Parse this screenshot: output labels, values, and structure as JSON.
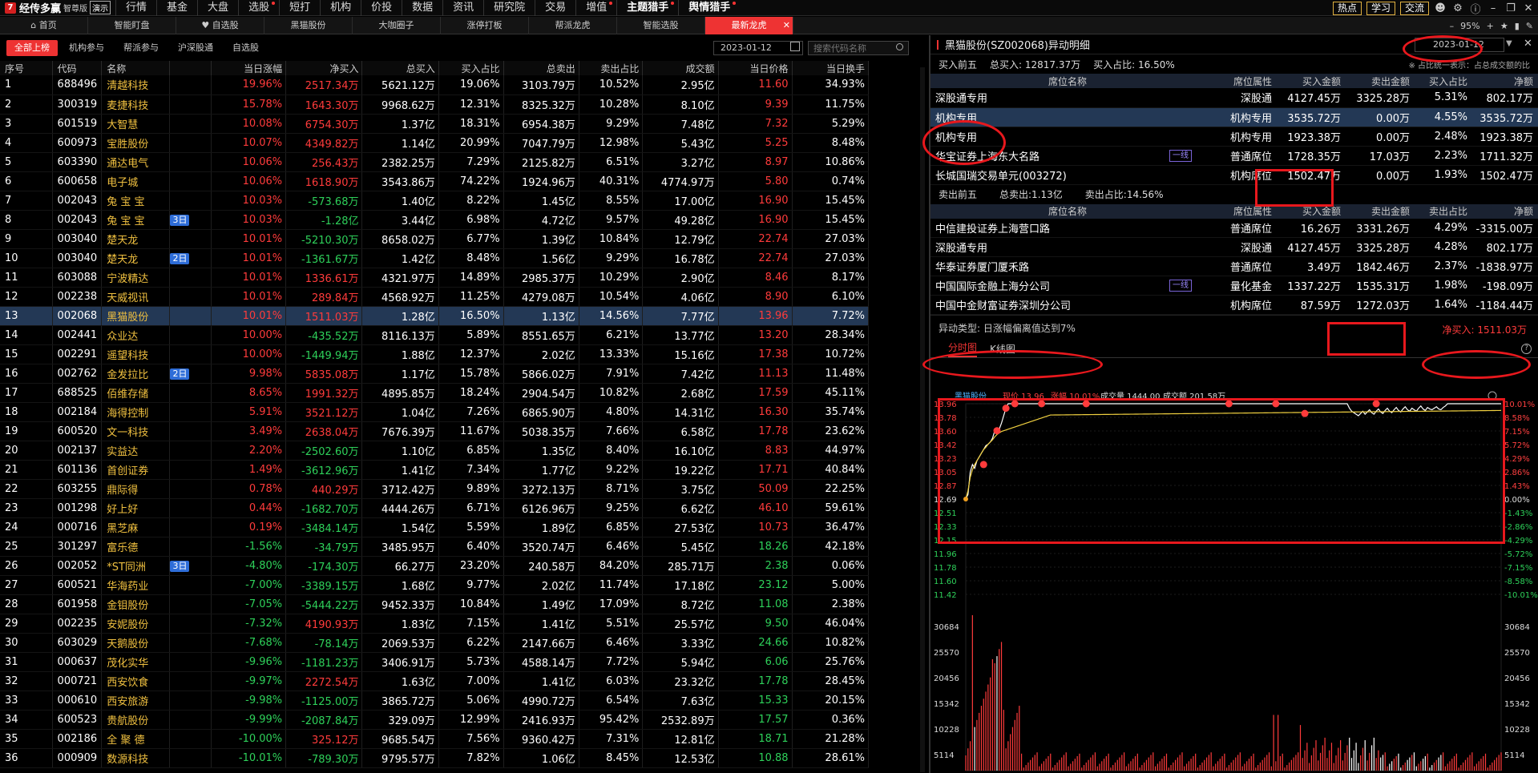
{
  "app": {
    "name": "经传多赢",
    "edition": "智尊版",
    "demo_label": "演示"
  },
  "menu": [
    "行情",
    "基金",
    "大盘",
    "选股",
    "短打",
    "机构",
    "价投",
    "数据",
    "资讯",
    "研究院",
    "交易",
    "增值",
    "主题猎手",
    "舆情猎手"
  ],
  "menu_dots": [
    3,
    11,
    12,
    13
  ],
  "top_buttons": [
    "热点",
    "学习",
    "交流"
  ],
  "tabs": [
    "首页",
    "智能盯盘",
    "自选股",
    "黑猫股份",
    "大咖圈子",
    "涨停打板",
    "帮派龙虎",
    "智能选股",
    "最新龙虎"
  ],
  "active_tab": 8,
  "zoom": "95%",
  "left": {
    "subtabs": [
      "全部上榜",
      "机构参与",
      "帮派参与",
      "沪深股通",
      "自选股"
    ],
    "date": "2023-01-12",
    "search_placeholder": "搜索代码名称",
    "headers": [
      "序号",
      "代码",
      "名称",
      "",
      "当日涨幅",
      "净买入",
      "总买入",
      "买入占比",
      "总卖出",
      "卖出占比",
      "成交额",
      "当日价格",
      "当日换手"
    ],
    "selected_row": 12,
    "rows": [
      [
        "1",
        "688496",
        "清越科技",
        "",
        "19.96%",
        "2517.34万",
        "5621.12万",
        "19.06%",
        "3103.79万",
        "10.52%",
        "2.95亿",
        "11.60",
        "34.93%"
      ],
      [
        "2",
        "300319",
        "麦捷科技",
        "",
        "15.78%",
        "1643.30万",
        "9968.62万",
        "12.31%",
        "8325.32万",
        "10.28%",
        "8.10亿",
        "9.39",
        "11.75%"
      ],
      [
        "3",
        "601519",
        "大智慧",
        "",
        "10.08%",
        "6754.30万",
        "1.37亿",
        "18.31%",
        "6954.38万",
        "9.29%",
        "7.48亿",
        "7.32",
        "5.29%"
      ],
      [
        "4",
        "600973",
        "宝胜股份",
        "",
        "10.07%",
        "4349.82万",
        "1.14亿",
        "20.99%",
        "7047.79万",
        "12.98%",
        "5.43亿",
        "5.25",
        "8.48%"
      ],
      [
        "5",
        "603390",
        "通达电气",
        "",
        "10.06%",
        "256.43万",
        "2382.25万",
        "7.29%",
        "2125.82万",
        "6.51%",
        "3.27亿",
        "8.97",
        "10.86%"
      ],
      [
        "6",
        "600658",
        "电子城",
        "",
        "10.06%",
        "1618.90万",
        "3543.86万",
        "74.22%",
        "1924.96万",
        "40.31%",
        "4774.97万",
        "5.80",
        "0.74%"
      ],
      [
        "7",
        "002043",
        "兔 宝 宝",
        "",
        "10.03%",
        "-573.68万",
        "1.40亿",
        "8.22%",
        "1.45亿",
        "8.55%",
        "17.00亿",
        "16.90",
        "15.45%"
      ],
      [
        "8",
        "002043",
        "兔 宝 宝",
        "3日",
        "10.03%",
        "-1.28亿",
        "3.44亿",
        "6.98%",
        "4.72亿",
        "9.57%",
        "49.28亿",
        "16.90",
        "15.45%"
      ],
      [
        "9",
        "003040",
        "楚天龙",
        "",
        "10.01%",
        "-5210.30万",
        "8658.02万",
        "6.77%",
        "1.39亿",
        "10.84%",
        "12.79亿",
        "22.74",
        "27.03%"
      ],
      [
        "10",
        "003040",
        "楚天龙",
        "2日",
        "10.01%",
        "-1361.67万",
        "1.42亿",
        "8.48%",
        "1.56亿",
        "9.29%",
        "16.78亿",
        "22.74",
        "27.03%"
      ],
      [
        "11",
        "603088",
        "宁波精达",
        "",
        "10.01%",
        "1336.61万",
        "4321.97万",
        "14.89%",
        "2985.37万",
        "10.29%",
        "2.90亿",
        "8.46",
        "8.17%"
      ],
      [
        "12",
        "002238",
        "天威视讯",
        "",
        "10.01%",
        "289.84万",
        "4568.92万",
        "11.25%",
        "4279.08万",
        "10.54%",
        "4.06亿",
        "8.90",
        "6.10%"
      ],
      [
        "13",
        "002068",
        "黑猫股份",
        "",
        "10.01%",
        "1511.03万",
        "1.28亿",
        "16.50%",
        "1.13亿",
        "14.56%",
        "7.77亿",
        "13.96",
        "7.72%"
      ],
      [
        "14",
        "002441",
        "众业达",
        "",
        "10.00%",
        "-435.52万",
        "8116.13万",
        "5.89%",
        "8551.65万",
        "6.21%",
        "13.77亿",
        "13.20",
        "28.34%"
      ],
      [
        "15",
        "002291",
        "遥望科技",
        "",
        "10.00%",
        "-1449.94万",
        "1.88亿",
        "12.37%",
        "2.02亿",
        "13.33%",
        "15.16亿",
        "17.38",
        "10.72%"
      ],
      [
        "16",
        "002762",
        "金发拉比",
        "2日",
        "9.98%",
        "5835.08万",
        "1.17亿",
        "15.78%",
        "5866.02万",
        "7.91%",
        "7.42亿",
        "11.13",
        "11.48%"
      ],
      [
        "17",
        "688525",
        "佰维存储",
        "",
        "8.65%",
        "1991.32万",
        "4895.85万",
        "18.24%",
        "2904.54万",
        "10.82%",
        "2.68亿",
        "17.59",
        "45.11%"
      ],
      [
        "18",
        "002184",
        "海得控制",
        "",
        "5.91%",
        "3521.12万",
        "1.04亿",
        "7.26%",
        "6865.90万",
        "4.80%",
        "14.31亿",
        "16.30",
        "35.74%"
      ],
      [
        "19",
        "600520",
        "文一科技",
        "",
        "3.49%",
        "2638.04万",
        "7676.39万",
        "11.67%",
        "5038.35万",
        "7.66%",
        "6.58亿",
        "17.78",
        "23.62%"
      ],
      [
        "20",
        "002137",
        "实益达",
        "",
        "2.20%",
        "-2502.60万",
        "1.10亿",
        "6.85%",
        "1.35亿",
        "8.40%",
        "16.10亿",
        "8.83",
        "44.97%"
      ],
      [
        "21",
        "601136",
        "首创证券",
        "",
        "1.49%",
        "-3612.96万",
        "1.41亿",
        "7.34%",
        "1.77亿",
        "9.22%",
        "19.22亿",
        "17.71",
        "40.84%"
      ],
      [
        "22",
        "603255",
        "鼎际得",
        "",
        "0.78%",
        "440.29万",
        "3712.42万",
        "9.89%",
        "3272.13万",
        "8.71%",
        "3.75亿",
        "50.09",
        "22.25%"
      ],
      [
        "23",
        "001298",
        "好上好",
        "",
        "0.44%",
        "-1682.70万",
        "4444.26万",
        "6.71%",
        "6126.96万",
        "9.25%",
        "6.62亿",
        "46.10",
        "59.61%"
      ],
      [
        "24",
        "000716",
        "黑芝麻",
        "",
        "0.19%",
        "-3484.14万",
        "1.54亿",
        "5.59%",
        "1.89亿",
        "6.85%",
        "27.53亿",
        "10.73",
        "36.47%"
      ],
      [
        "25",
        "301297",
        "富乐德",
        "",
        "-1.56%",
        "-34.79万",
        "3485.95万",
        "6.40%",
        "3520.74万",
        "6.46%",
        "5.45亿",
        "18.26",
        "42.18%"
      ],
      [
        "26",
        "002052",
        "*ST同洲",
        "3日",
        "-4.80%",
        "-174.30万",
        "66.27万",
        "23.20%",
        "240.58万",
        "84.20%",
        "285.71万",
        "2.38",
        "0.06%"
      ],
      [
        "27",
        "600521",
        "华海药业",
        "",
        "-7.00%",
        "-3389.15万",
        "1.68亿",
        "9.77%",
        "2.02亿",
        "11.74%",
        "17.18亿",
        "23.12",
        "5.00%"
      ],
      [
        "28",
        "601958",
        "金钼股份",
        "",
        "-7.05%",
        "-5444.22万",
        "9452.33万",
        "10.84%",
        "1.49亿",
        "17.09%",
        "8.72亿",
        "11.08",
        "2.38%"
      ],
      [
        "29",
        "002235",
        "安妮股份",
        "",
        "-7.32%",
        "4190.93万",
        "1.83亿",
        "7.15%",
        "1.41亿",
        "5.51%",
        "25.57亿",
        "9.50",
        "46.04%"
      ],
      [
        "30",
        "603029",
        "天鹅股份",
        "",
        "-7.68%",
        "-78.14万",
        "2069.53万",
        "6.22%",
        "2147.66万",
        "6.46%",
        "3.33亿",
        "24.66",
        "10.82%"
      ],
      [
        "31",
        "000637",
        "茂化实华",
        "",
        "-9.96%",
        "-1181.23万",
        "3406.91万",
        "5.73%",
        "4588.14万",
        "7.72%",
        "5.94亿",
        "6.06",
        "25.76%"
      ],
      [
        "32",
        "000721",
        "西安饮食",
        "",
        "-9.97%",
        "2272.54万",
        "1.63亿",
        "7.00%",
        "1.41亿",
        "6.03%",
        "23.32亿",
        "17.78",
        "28.45%"
      ],
      [
        "33",
        "000610",
        "西安旅游",
        "",
        "-9.98%",
        "-1125.00万",
        "3865.72万",
        "5.06%",
        "4990.72万",
        "6.54%",
        "7.63亿",
        "15.33",
        "20.15%"
      ],
      [
        "34",
        "600523",
        "贵航股份",
        "",
        "-9.99%",
        "-2087.84万",
        "329.09万",
        "12.99%",
        "2416.93万",
        "95.42%",
        "2532.89万",
        "17.57",
        "0.36%"
      ],
      [
        "35",
        "002186",
        "全 聚 德",
        "",
        "-10.00%",
        "325.12万",
        "9685.54万",
        "7.56%",
        "9360.42万",
        "7.31%",
        "12.81亿",
        "18.71",
        "21.28%"
      ],
      [
        "36",
        "000909",
        "数源科技",
        "",
        "-10.01%",
        "-789.30万",
        "9795.57万",
        "7.82%",
        "1.06亿",
        "8.45%",
        "12.53亿",
        "10.88",
        "28.61%"
      ]
    ]
  },
  "right": {
    "title": "黑猫股份(SZ002068)异动明细",
    "date": "2023-01-12",
    "buy_summary": {
      "label": "买入前五",
      "total": "总买入: 12817.37万",
      "ratio": "买入占比: 16.50%"
    },
    "ratio_note": "※ 占比统一表示：占总成交额的比",
    "buy_headers": [
      "席位名称",
      "席位属性",
      "买入金额",
      "卖出金额",
      "买入占比",
      "净额"
    ],
    "buy_selected": 1,
    "buy_rows": [
      [
        "深股通专用",
        "",
        "深股通",
        "4127.45万",
        "3325.28万",
        "5.31%",
        "802.17万"
      ],
      [
        "机构专用",
        "",
        "机构专用",
        "3535.72万",
        "0.00万",
        "4.55%",
        "3535.72万"
      ],
      [
        "机构专用",
        "",
        "机构专用",
        "1923.38万",
        "0.00万",
        "2.48%",
        "1923.38万"
      ],
      [
        "华宝证券上海东大名路",
        "一线",
        "普通席位",
        "1728.35万",
        "17.03万",
        "2.23%",
        "1711.32万"
      ],
      [
        "长城国瑞交易单元(003272)",
        "",
        "机构席位",
        "1502.47万",
        "0.00万",
        "1.93%",
        "1502.47万"
      ]
    ],
    "sell_summary": {
      "label": "卖出前五",
      "total": "总卖出:1.13亿",
      "ratio": "卖出占比:14.56%"
    },
    "sell_headers": [
      "席位名称",
      "席位属性",
      "买入金额",
      "卖出金额",
      "卖出占比",
      "净额"
    ],
    "sell_rows": [
      [
        "中信建投证券上海营口路",
        "",
        "普通席位",
        "16.26万",
        "3331.26万",
        "4.29%",
        "-3315.00万"
      ],
      [
        "深股通专用",
        "",
        "深股通",
        "4127.45万",
        "3325.28万",
        "4.28%",
        "802.17万"
      ],
      [
        "华泰证券厦门厦禾路",
        "",
        "普通席位",
        "3.49万",
        "1842.46万",
        "2.37%",
        "-1838.97万"
      ],
      [
        "中国国际金融上海分公司",
        "一线",
        "量化基金",
        "1337.22万",
        "1535.31万",
        "1.98%",
        "-198.09万"
      ],
      [
        "中国中金财富证券深圳分公司",
        "",
        "机构席位",
        "87.59万",
        "1272.03万",
        "1.64%",
        "-1184.44万"
      ]
    ],
    "anomaly": "异动类型:  日涨幅偏离值达到7%",
    "net_buy": "净买入: 1511.03万",
    "chart_tabs": [
      "分时图",
      "K线图"
    ]
  },
  "chart_data": {
    "type": "line",
    "legend": {
      "name": "黑猫股份",
      "price": "现价 13.96",
      "change": "涨幅 10.01%",
      "volume": "成交量 1444.00",
      "amount": "成交额 201.58万"
    },
    "price_ticks": [
      "13.96",
      "13.78",
      "13.60",
      "13.42",
      "13.23",
      "13.05",
      "12.87",
      "12.69",
      "12.51",
      "12.33",
      "12.15",
      "11.96",
      "11.78",
      "11.60",
      "11.42"
    ],
    "pct_ticks": [
      "10.01%",
      "8.58%",
      "7.15%",
      "5.72%",
      "4.29%",
      "2.86%",
      "1.43%",
      "0.00%",
      "-1.43%",
      "-2.86%",
      "-4.29%",
      "-5.72%",
      "-7.15%",
      "-8.58%",
      "-10.01%"
    ],
    "volume_ticks": [
      "30684",
      "25570",
      "20456",
      "15342",
      "10228",
      "5114"
    ],
    "ylim": [
      11.42,
      13.96
    ],
    "prev_close": 12.69,
    "price": [
      12.69,
      12.75,
      13.05,
      13.15,
      13.1,
      13.2,
      13.25,
      13.3,
      13.35,
      13.4,
      13.42,
      13.45,
      13.5,
      13.6,
      13.58,
      13.62,
      13.7,
      13.8,
      13.9,
      13.96,
      13.96,
      13.96,
      13.96,
      13.96,
      13.96,
      13.96,
      13.96,
      13.96,
      13.96,
      13.96,
      13.96,
      13.96,
      13.96,
      13.96,
      13.96,
      13.96,
      13.96,
      13.96,
      13.96,
      13.96,
      13.96,
      13.96,
      13.96,
      13.96,
      13.96,
      13.96,
      13.96,
      13.96,
      13.96,
      13.96,
      13.96,
      13.96,
      13.96,
      13.96,
      13.96,
      13.96,
      13.96,
      13.96,
      13.96,
      13.96,
      13.96,
      13.96,
      13.96,
      13.96,
      13.96,
      13.96,
      13.96,
      13.96,
      13.96,
      13.96,
      13.96,
      13.96,
      13.96,
      13.96,
      13.96,
      13.96,
      13.96,
      13.96,
      13.96,
      13.96,
      13.96,
      13.96,
      13.96,
      13.96,
      13.96,
      13.96,
      13.96,
      13.96,
      13.96,
      13.96,
      13.96,
      13.96,
      13.96,
      13.96,
      13.96,
      13.96,
      13.96,
      13.96,
      13.96,
      13.96,
      13.96,
      13.96,
      13.96,
      13.96,
      13.96,
      13.96,
      13.96,
      13.96,
      13.96,
      13.96,
      13.96,
      13.96,
      13.96,
      13.96,
      13.96,
      13.96,
      13.96,
      13.96,
      13.96,
      13.96,
      13.96,
      13.96,
      13.96,
      13.96,
      13.96,
      13.96,
      13.96,
      13.96,
      13.96,
      13.96,
      13.96,
      13.96,
      13.96,
      13.96,
      13.96,
      13.96,
      13.96,
      13.96,
      13.96,
      13.96,
      13.96,
      13.96,
      13.96,
      13.96,
      13.96,
      13.96,
      13.96,
      13.96,
      13.96,
      13.96,
      13.96,
      13.96,
      13.96,
      13.96,
      13.96,
      13.96,
      13.96,
      13.96,
      13.96,
      13.96,
      13.96,
      13.96,
      13.96,
      13.96,
      13.96,
      13.96,
      13.96,
      13.96,
      13.96,
      13.96,
      13.96,
      13.96,
      13.9,
      13.86,
      13.84,
      13.82,
      13.8,
      13.83,
      13.86,
      13.82,
      13.85,
      13.88,
      13.84,
      13.82,
      13.86,
      13.89,
      13.85,
      13.83,
      13.87,
      13.9,
      13.86,
      13.84,
      13.88,
      13.91,
      13.87,
      13.85,
      13.89,
      13.92,
      13.88,
      13.86,
      13.9,
      13.88,
      13.86,
      13.9,
      13.93,
      13.89,
      13.87,
      13.91,
      13.89,
      13.88,
      13.9,
      13.92,
      13.89,
      13.88,
      13.91,
      13.93,
      13.96,
      13.96,
      13.96,
      13.96,
      13.96,
      13.96,
      13.96,
      13.96,
      13.96,
      13.96,
      13.96,
      13.96,
      13.96,
      13.96,
      13.96,
      13.96,
      13.96,
      13.96,
      13.96,
      13.96,
      13.96,
      13.96,
      13.96,
      13.96,
      13.96
    ],
    "avg": [
      12.69,
      12.8,
      12.98,
      13.08,
      13.15,
      13.2,
      13.25,
      13.3,
      13.35,
      13.38,
      13.42,
      13.45,
      13.48,
      13.52,
      13.55,
      13.57,
      13.59,
      13.6,
      13.61,
      13.62,
      13.63,
      13.64,
      13.65,
      13.66,
      13.67,
      13.68,
      13.69,
      13.7,
      13.71,
      13.72,
      13.73,
      13.74,
      13.75,
      13.76,
      13.77,
      13.78,
      13.79,
      13.8,
      13.81
    ]
  }
}
